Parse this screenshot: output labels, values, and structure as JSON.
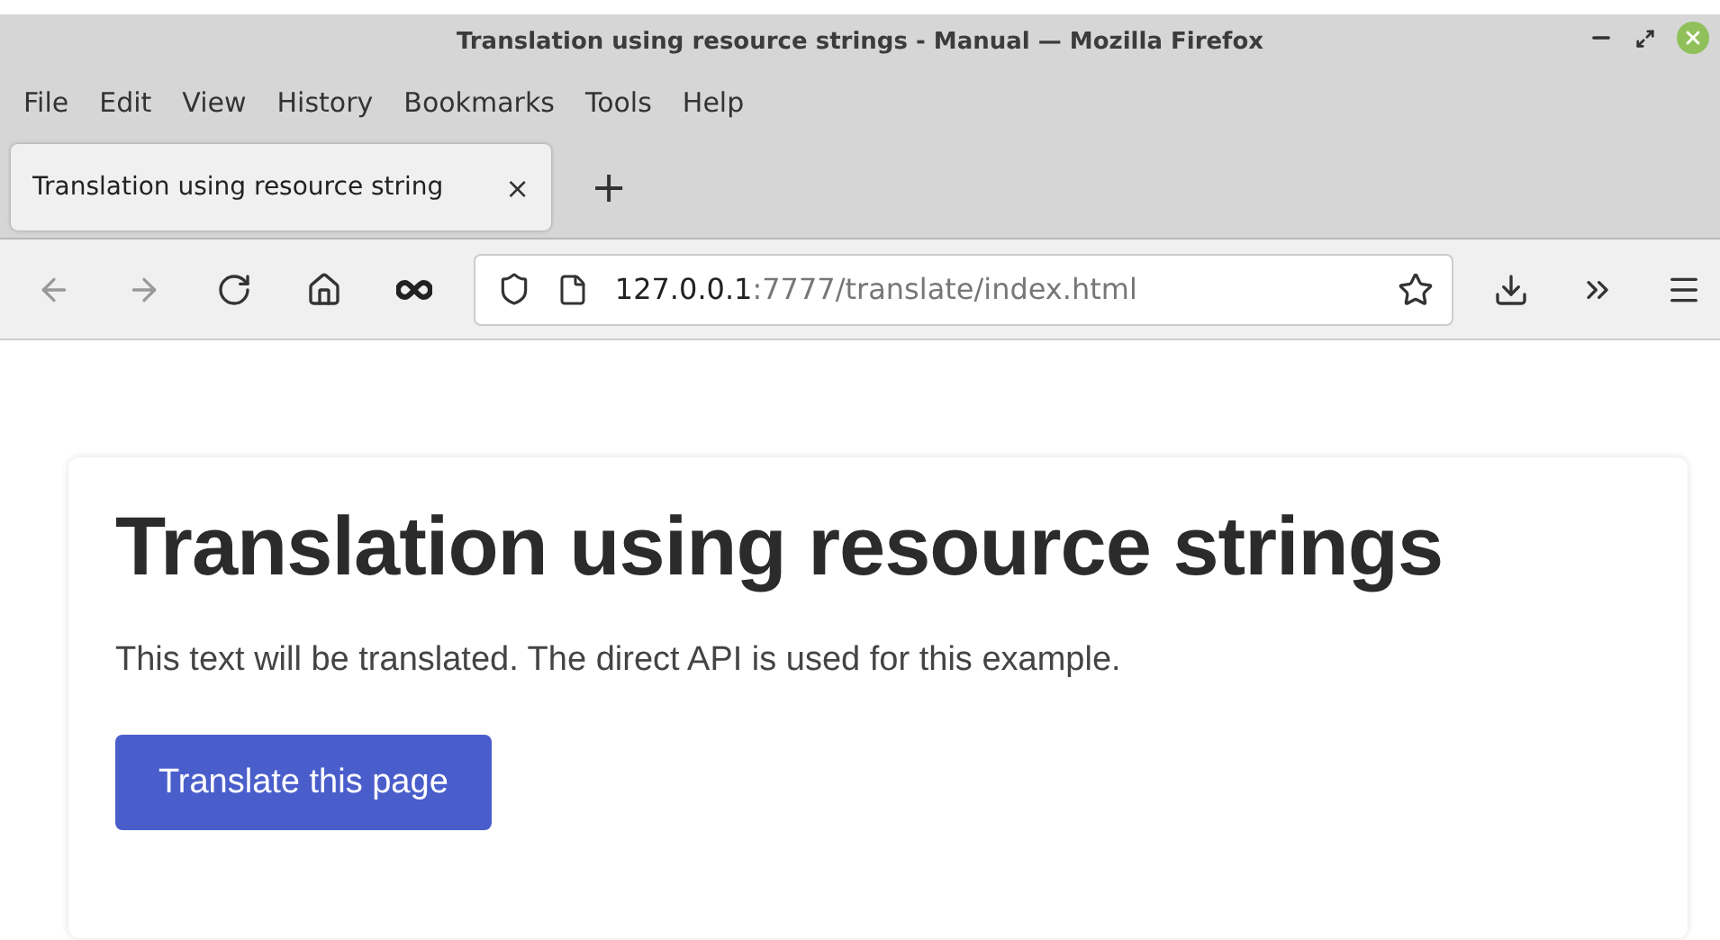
{
  "window": {
    "title": "Translation using resource strings - Manual — Mozilla Firefox"
  },
  "menu": [
    "File",
    "Edit",
    "View",
    "History",
    "Bookmarks",
    "Tools",
    "Help"
  ],
  "tabs": [
    {
      "label": "Translation using resource string",
      "selected": true,
      "close": "×"
    }
  ],
  "new_tab": "+",
  "address_bar": {
    "host": "127.0.0.1",
    "path": ":7777/translate/index.html"
  },
  "page": {
    "heading": "Translation using resource strings",
    "text": "This text will be translated. The direct API is used for this example.",
    "button": "Translate this page"
  }
}
